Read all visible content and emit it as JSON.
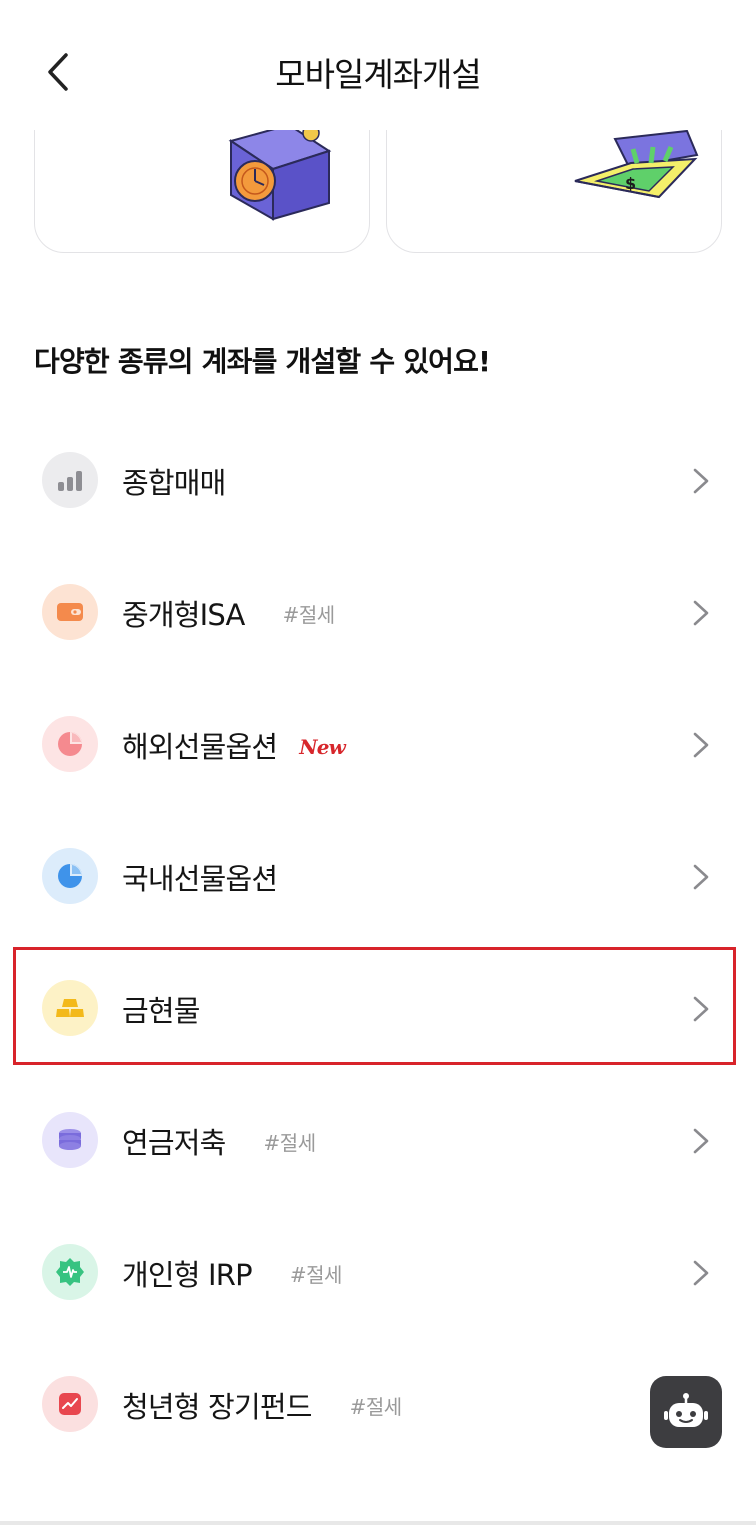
{
  "header": {
    "title": "모바일계좌개설"
  },
  "section": {
    "title": "다양한 종류의 계좌를 개설할 수 있어요!"
  },
  "accounts": [
    {
      "label": "종합매매",
      "tag": "",
      "badge": "",
      "icon": "bar-chart-icon",
      "icon_bg": "#ececee"
    },
    {
      "label": "중개형ISA",
      "tag": "#절세",
      "badge": "",
      "icon": "wallet-icon",
      "icon_bg": "#fde3d3"
    },
    {
      "label": "해외선물옵션",
      "tag": "",
      "badge": "New",
      "icon": "pie-chart-icon",
      "icon_bg": "#fde4e4"
    },
    {
      "label": "국내선물옵션",
      "tag": "",
      "badge": "",
      "icon": "pie-chart-icon",
      "icon_bg": "#dcecfb"
    },
    {
      "label": "금현물",
      "tag": "",
      "badge": "",
      "icon": "gold-bars-icon",
      "icon_bg": "#fdf2c6"
    },
    {
      "label": "연금저축",
      "tag": "#절세",
      "badge": "",
      "icon": "coin-stack-icon",
      "icon_bg": "#e8e5fb"
    },
    {
      "label": "개인형 IRP",
      "tag": "#절세",
      "badge": "",
      "icon": "pulse-badge-icon",
      "icon_bg": "#d9f5e7"
    },
    {
      "label": "청년형 장기펀드",
      "tag": "#절세",
      "badge": "",
      "icon": "trend-chart-icon",
      "icon_bg": "#fbe0e0"
    }
  ],
  "colors": {
    "highlight": "#d8232a",
    "new_badge": "#d7262b",
    "tag_text": "#9a9a9a",
    "bot_button": "#3d3d40"
  }
}
